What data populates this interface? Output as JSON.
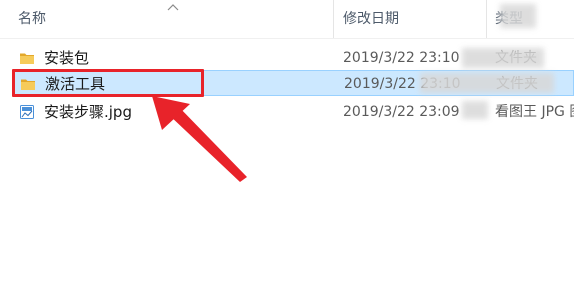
{
  "columns": {
    "name": "名称",
    "date": "修改日期",
    "type": "类型"
  },
  "files": [
    {
      "name": "安装包",
      "date": "2019/3/22 23:10",
      "type": "文件夹",
      "icon": "folder-icon",
      "selected": false
    },
    {
      "name": "激活工具",
      "date": "2019/3/22 23:10",
      "type": "文件夹",
      "icon": "folder-icon",
      "selected": true
    },
    {
      "name": "安装步骤.jpg",
      "date": "2019/3/22 23:09",
      "type": "看图王 JPG 图片文件",
      "icon": "image-file-icon",
      "selected": false
    }
  ],
  "colors": {
    "selected_bg": "#cce8ff",
    "selected_border": "#99d1ff",
    "annotation_red": "#e8232a",
    "folder_yellow": "#f4c542"
  }
}
